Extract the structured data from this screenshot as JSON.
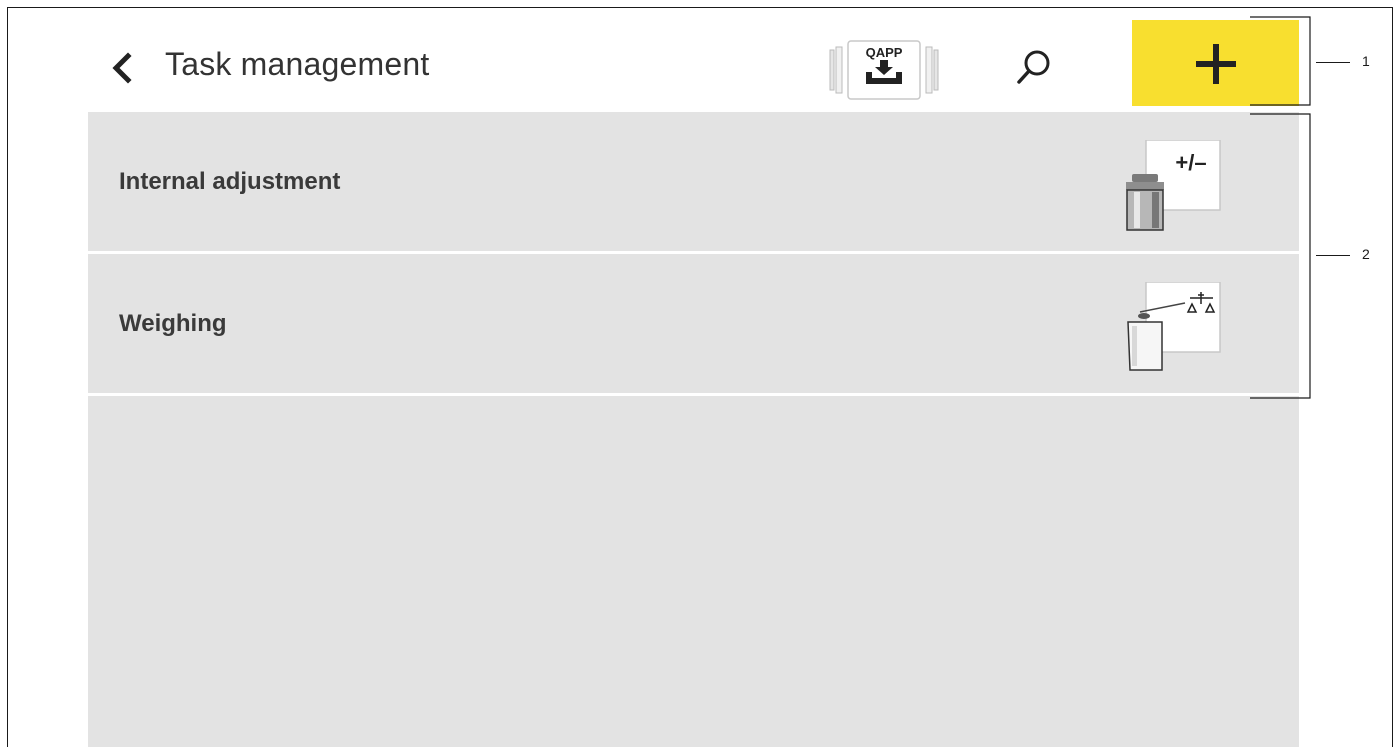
{
  "header": {
    "title": "Task management",
    "back_icon": "chevron-left-icon",
    "qapp_badge": "QAPP",
    "search_icon": "search-icon",
    "add_icon": "plus-icon"
  },
  "tasks": [
    {
      "label": "Internal adjustment",
      "icon": "adjustment-weight-icon",
      "icon_text": "+/–"
    },
    {
      "label": "Weighing",
      "icon": "weighing-balance-icon"
    }
  ],
  "callouts": [
    "1",
    "2"
  ],
  "colors": {
    "accent": "#f8df2f",
    "list_bg": "#e3e3e3",
    "text": "#333333"
  }
}
